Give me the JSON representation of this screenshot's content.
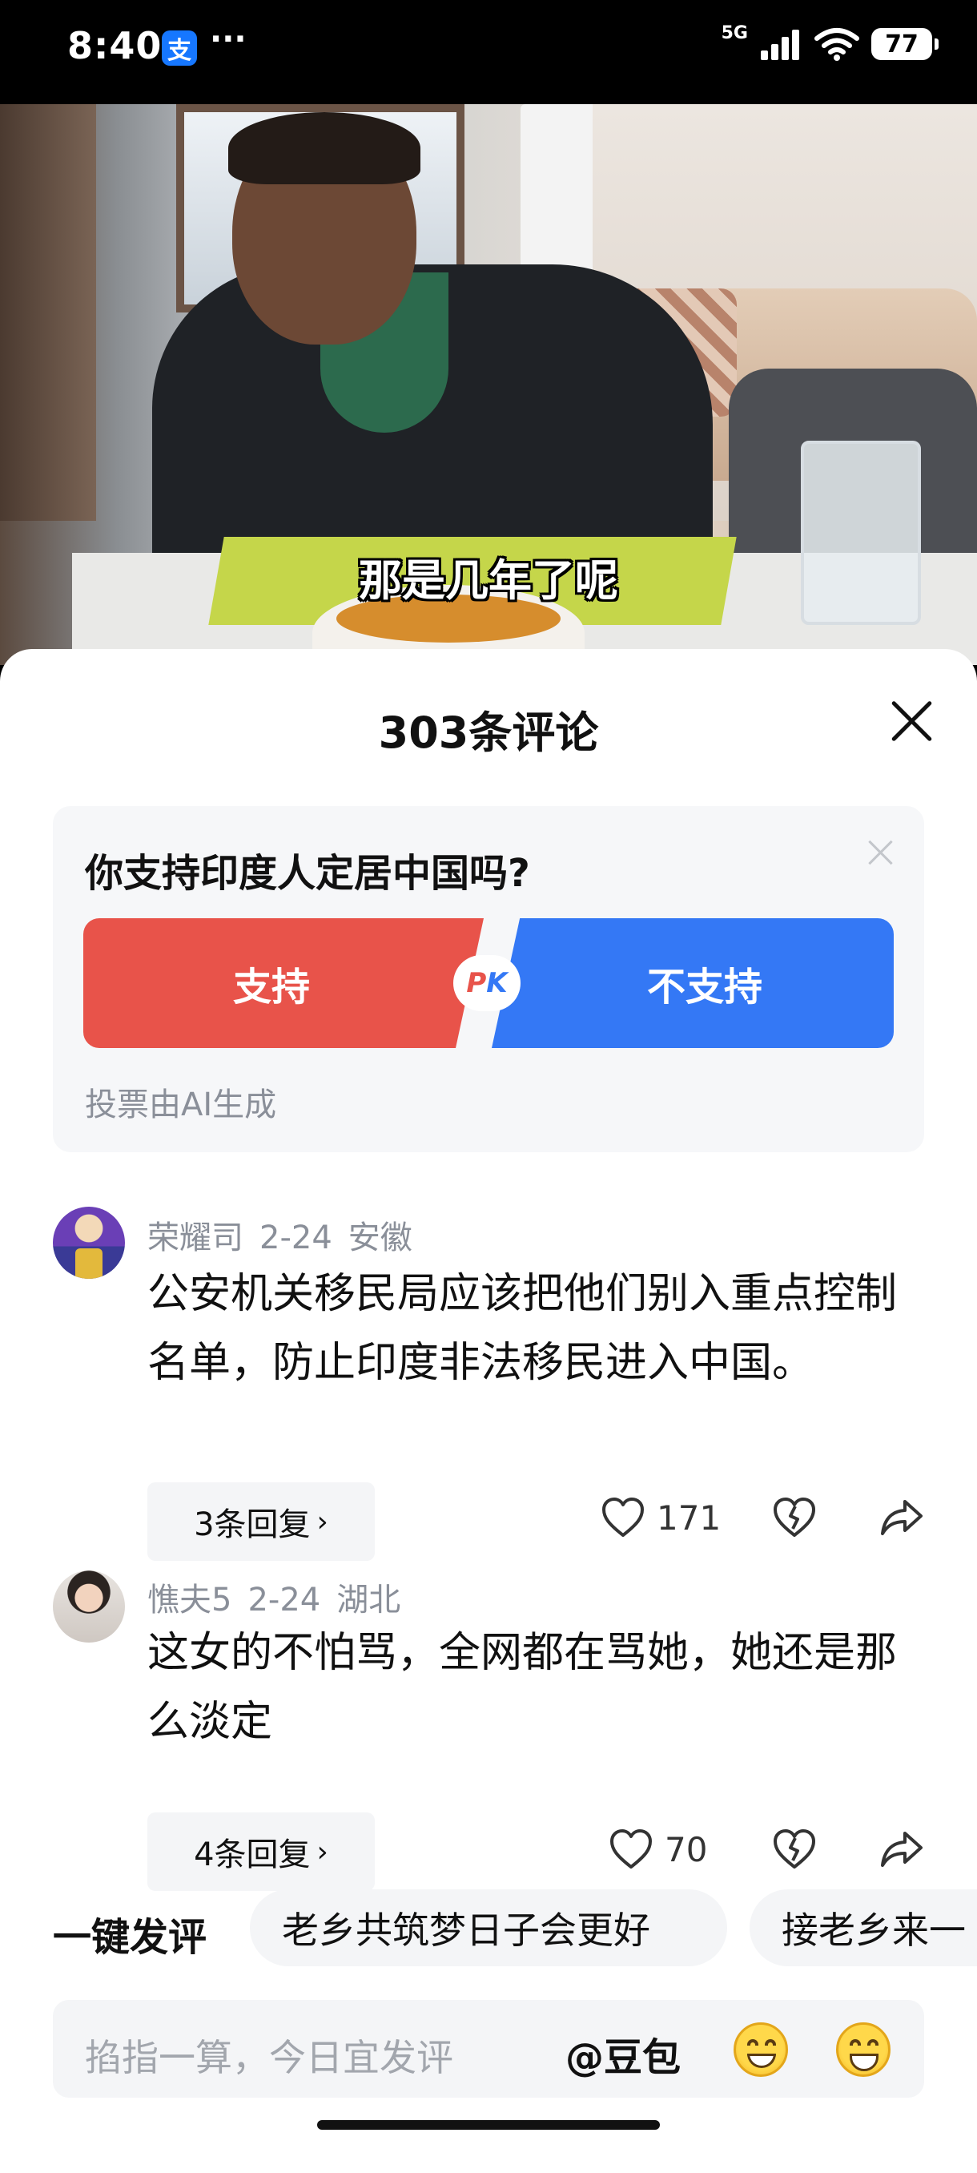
{
  "status_bar": {
    "time": "8:40",
    "app_badge": "支",
    "dots": "···",
    "network": "5G",
    "battery": "77"
  },
  "video": {
    "subtitle": "那是几年了呢"
  },
  "sheet": {
    "title": "303条评论"
  },
  "poll": {
    "question": "你支持印度人定居中国吗?",
    "option_support": "支持",
    "option_oppose": "不支持",
    "pk_p": "P",
    "pk_k": "K",
    "note": "投票由AI生成",
    "colors": {
      "support": "#e8534a",
      "oppose": "#3478f5"
    }
  },
  "comments": [
    {
      "author": "荣耀司",
      "date": "2-24",
      "location": "安徽",
      "text": "公安机关移民局应该把他们别入重点控制名单，防止印度非法移民进入中国。",
      "replies": "3条回复",
      "likes": "171"
    },
    {
      "author": "憔夫5",
      "date": "2-24",
      "location": "湖北",
      "text": "这女的不怕骂，全网都在骂她，她还是那么淡定",
      "replies": "4条回复",
      "likes": "70"
    }
  ],
  "quick_comments": {
    "label": "一键发评",
    "chips": [
      "老乡共筑梦日子会更好",
      "接老乡来一"
    ]
  },
  "input_bar": {
    "placeholder": "掐指一算，今日宜发评",
    "mention": "@豆包"
  }
}
